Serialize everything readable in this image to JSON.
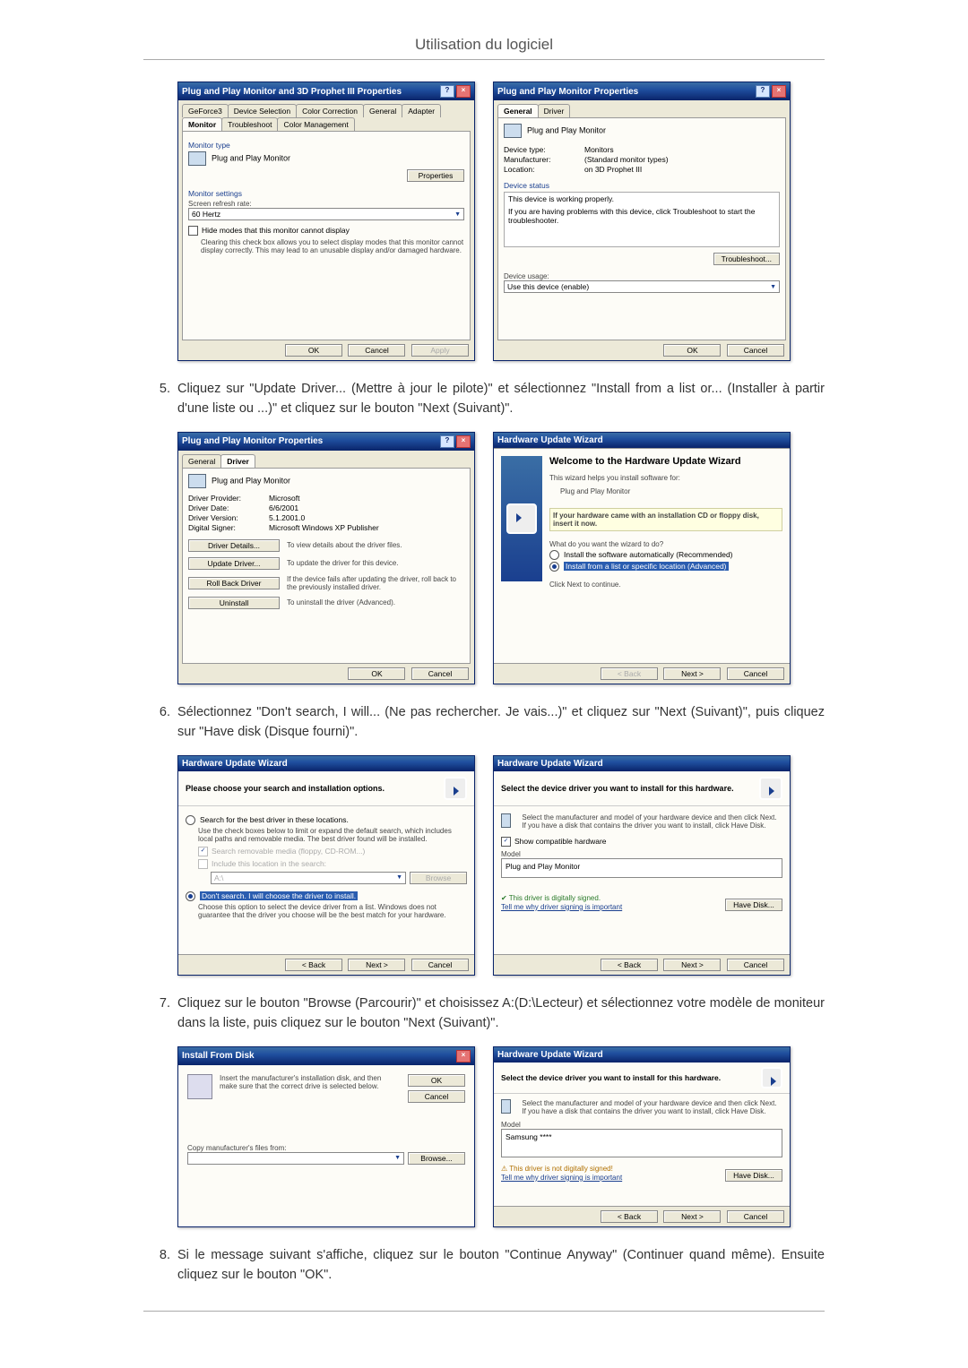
{
  "page_title": "Utilisation du logiciel",
  "steps": [
    {
      "num": "5.",
      "text": "Cliquez sur \"Update Driver... (Mettre à jour le pilote)\" et sélectionnez \"Install from a list or... (Installer à partir d'une liste ou ...)\" et cliquez sur le bouton \"Next (Suivant)\"."
    },
    {
      "num": "6.",
      "text": "Sélectionnez \"Don't search, I will... (Ne pas rechercher. Je vais...)\" et cliquez sur \"Next (Suivant)\", puis cliquez sur \"Have disk (Disque fourni)\"."
    },
    {
      "num": "7.",
      "text": "Cliquez sur le bouton \"Browse (Parcourir)\" et choisissez A:(D:\\Lecteur) et sélectionnez votre modèle de moniteur dans la liste, puis cliquez sur le bouton \"Next (Suivant)\"."
    },
    {
      "num": "8.",
      "text": "Si le message suivant s'affiche, cliquez sur le bouton \"Continue Anyway\" (Continuer quand même). Ensuite cliquez sur le bouton \"OK\"."
    }
  ],
  "d1a": {
    "title": "Plug and Play Monitor and 3D Prophet III Properties",
    "tabs": [
      "GeForce3",
      "Device Selection",
      "Color Correction",
      "General",
      "Adapter",
      "Monitor",
      "Troubleshoot",
      "Color Management"
    ],
    "monitor_type_heading": "Monitor type",
    "monitor_name": "Plug and Play Monitor",
    "properties": "Properties",
    "monitor_settings": "Monitor settings",
    "refresh_label": "Screen refresh rate:",
    "refresh_value": "60 Hertz",
    "hide_modes": "Hide modes that this monitor cannot display",
    "hide_hint": "Clearing this check box allows you to select display modes that this monitor cannot display correctly. This may lead to an unusable display and/or damaged hardware.",
    "ok": "OK",
    "cancel": "Cancel",
    "apply": "Apply"
  },
  "d1b": {
    "title": "Plug and Play Monitor Properties",
    "tabs": [
      "General",
      "Driver"
    ],
    "name": "Plug and Play Monitor",
    "devtype_k": "Device type:",
    "devtype_v": "Monitors",
    "manu_k": "Manufacturer:",
    "manu_v": "(Standard monitor types)",
    "loc_k": "Location:",
    "loc_v": "on 3D Prophet III",
    "status_heading": "Device status",
    "status_ok": "This device is working properly.",
    "status_hint": "If you are having problems with this device, click Troubleshoot to start the troubleshooter.",
    "troubleshoot": "Troubleshoot...",
    "usage_label": "Device usage:",
    "usage_value": "Use this device (enable)",
    "ok": "OK",
    "cancel": "Cancel"
  },
  "d2a": {
    "title": "Plug and Play Monitor Properties",
    "tabs": [
      "General",
      "Driver"
    ],
    "name": "Plug and Play Monitor",
    "prov_k": "Driver Provider:",
    "prov_v": "Microsoft",
    "date_k": "Driver Date:",
    "date_v": "6/6/2001",
    "ver_k": "Driver Version:",
    "ver_v": "5.1.2001.0",
    "sign_k": "Digital Signer:",
    "sign_v": "Microsoft Windows XP Publisher",
    "details_btn": "Driver Details...",
    "details_txt": "To view details about the driver files.",
    "update_btn": "Update Driver...",
    "update_txt": "To update the driver for this device.",
    "rollback_btn": "Roll Back Driver",
    "rollback_txt": "If the device fails after updating the driver, roll back to the previously installed driver.",
    "uninstall_btn": "Uninstall",
    "uninstall_txt": "To uninstall the driver (Advanced).",
    "ok": "OK",
    "cancel": "Cancel"
  },
  "d2b": {
    "title": "Hardware Update Wizard",
    "heading": "Welcome to the Hardware Update Wizard",
    "intro": "This wizard helps you install software for:",
    "device": "Plug and Play Monitor",
    "cd_hint": "If your hardware came with an installation CD or floppy disk, insert it now.",
    "question": "What do you want the wizard to do?",
    "opt1": "Install the software automatically (Recommended)",
    "opt2": "Install from a list or specific location (Advanced)",
    "click_next": "Click Next to continue.",
    "back": "< Back",
    "next": "Next >",
    "cancel": "Cancel"
  },
  "d3a": {
    "title": "Hardware Update Wizard",
    "heading": "Please choose your search and installation options.",
    "opt1": "Search for the best driver in these locations.",
    "opt1_hint": "Use the check boxes below to limit or expand the default search, which includes local paths and removable media. The best driver found will be installed.",
    "sub1": "Search removable media (floppy, CD-ROM...)",
    "sub2": "Include this location in the search:",
    "path": "A:\\",
    "browse": "Browse",
    "opt2": "Don't search. I will choose the driver to install.",
    "opt2_hint": "Choose this option to select the device driver from a list. Windows does not guarantee that the driver you choose will be the best match for your hardware.",
    "back": "< Back",
    "next": "Next >",
    "cancel": "Cancel"
  },
  "d3b": {
    "title": "Hardware Update Wizard",
    "heading": "Select the device driver you want to install for this hardware.",
    "hint": "Select the manufacturer and model of your hardware device and then click Next. If you have a disk that contains the driver you want to install, click Have Disk.",
    "compat": "Show compatible hardware",
    "model_label": "Model",
    "model": "Plug and Play Monitor",
    "signed": "This driver is digitally signed.",
    "tell": "Tell me why driver signing is important",
    "havedisk": "Have Disk...",
    "back": "< Back",
    "next": "Next >",
    "cancel": "Cancel"
  },
  "d4a": {
    "title": "Install From Disk",
    "hint": "Insert the manufacturer's installation disk, and then make sure that the correct drive is selected below.",
    "ok": "OK",
    "cancel": "Cancel",
    "copy_label": "Copy manufacturer's files from:",
    "path": "",
    "browse": "Browse..."
  },
  "d4b": {
    "title": "Hardware Update Wizard",
    "heading": "Select the device driver you want to install for this hardware.",
    "hint": "Select the manufacturer and model of your hardware device and then click Next. If you have a disk that contains the driver you want to install, click Have Disk.",
    "model_label": "Model",
    "model": "Samsung ****",
    "unsigned": "This driver is not digitally signed!",
    "tell": "Tell me why driver signing is important",
    "havedisk": "Have Disk...",
    "back": "< Back",
    "next": "Next >",
    "cancel": "Cancel"
  }
}
